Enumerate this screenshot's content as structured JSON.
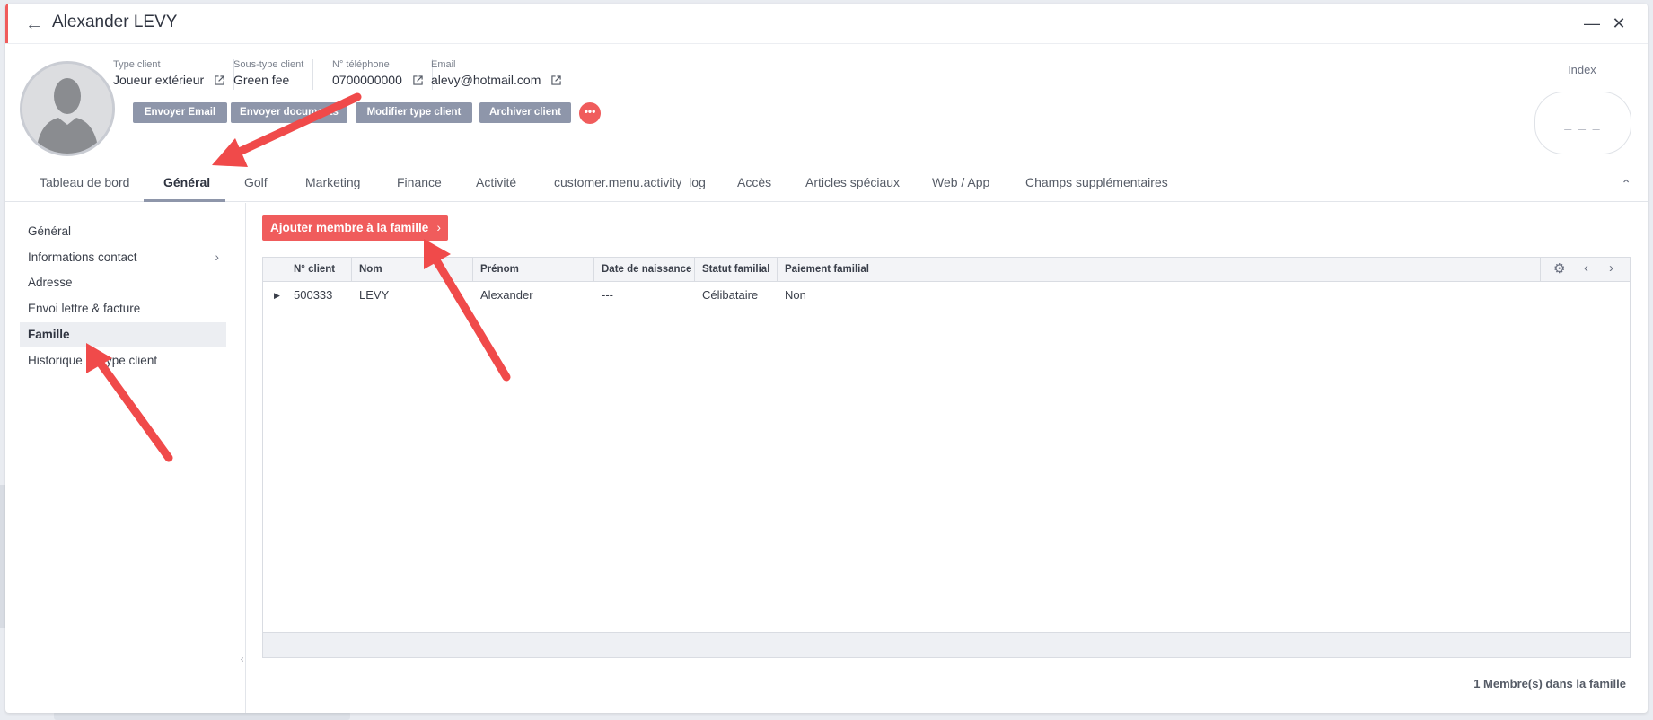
{
  "window": {
    "title": "Alexander LEVY",
    "accent_color": "#f05c5c"
  },
  "profile": {
    "fields": [
      {
        "label": "Type client",
        "value": "Joueur extérieur",
        "link": true
      },
      {
        "label": "Sous-type client",
        "value": "Green fee",
        "link": false
      },
      {
        "label": "N° téléphone",
        "value": "0700000000",
        "link": true
      },
      {
        "label": "Email",
        "value": "alevy@hotmail.com",
        "link": true
      }
    ],
    "actions": {
      "send_email": "Envoyer Email",
      "send_documents": "Envoyer documents",
      "modify_type": "Modifier type client",
      "archive": "Archiver client",
      "more": "•••"
    },
    "index_label": "Index",
    "index_value": "_ _ _"
  },
  "tabs": [
    "Tableau de bord",
    "Général",
    "Golf",
    "Marketing",
    "Finance",
    "Activité",
    "customer.menu.activity_log",
    "Accès",
    "Articles spéciaux",
    "Web / App",
    "Champs supplémentaires"
  ],
  "active_tab": "Général",
  "sidebar": {
    "items": [
      "Général",
      "Informations contact",
      "Adresse",
      "Envoi lettre & facture",
      "Famille",
      "Historique du type client"
    ],
    "active": "Famille"
  },
  "family": {
    "add_button": "Ajouter membre à la famille",
    "columns": [
      "N° client",
      "Nom",
      "Prénom",
      "Date de naissance",
      "Statut familial",
      "Paiement familial"
    ],
    "rows": [
      {
        "client_no": "500333",
        "nom": "LEVY",
        "prenom": "Alexander",
        "date_naissance": "---",
        "statut": "Célibataire",
        "paiement": "Non"
      }
    ],
    "summary": "1 Membre(s) dans la famille"
  }
}
